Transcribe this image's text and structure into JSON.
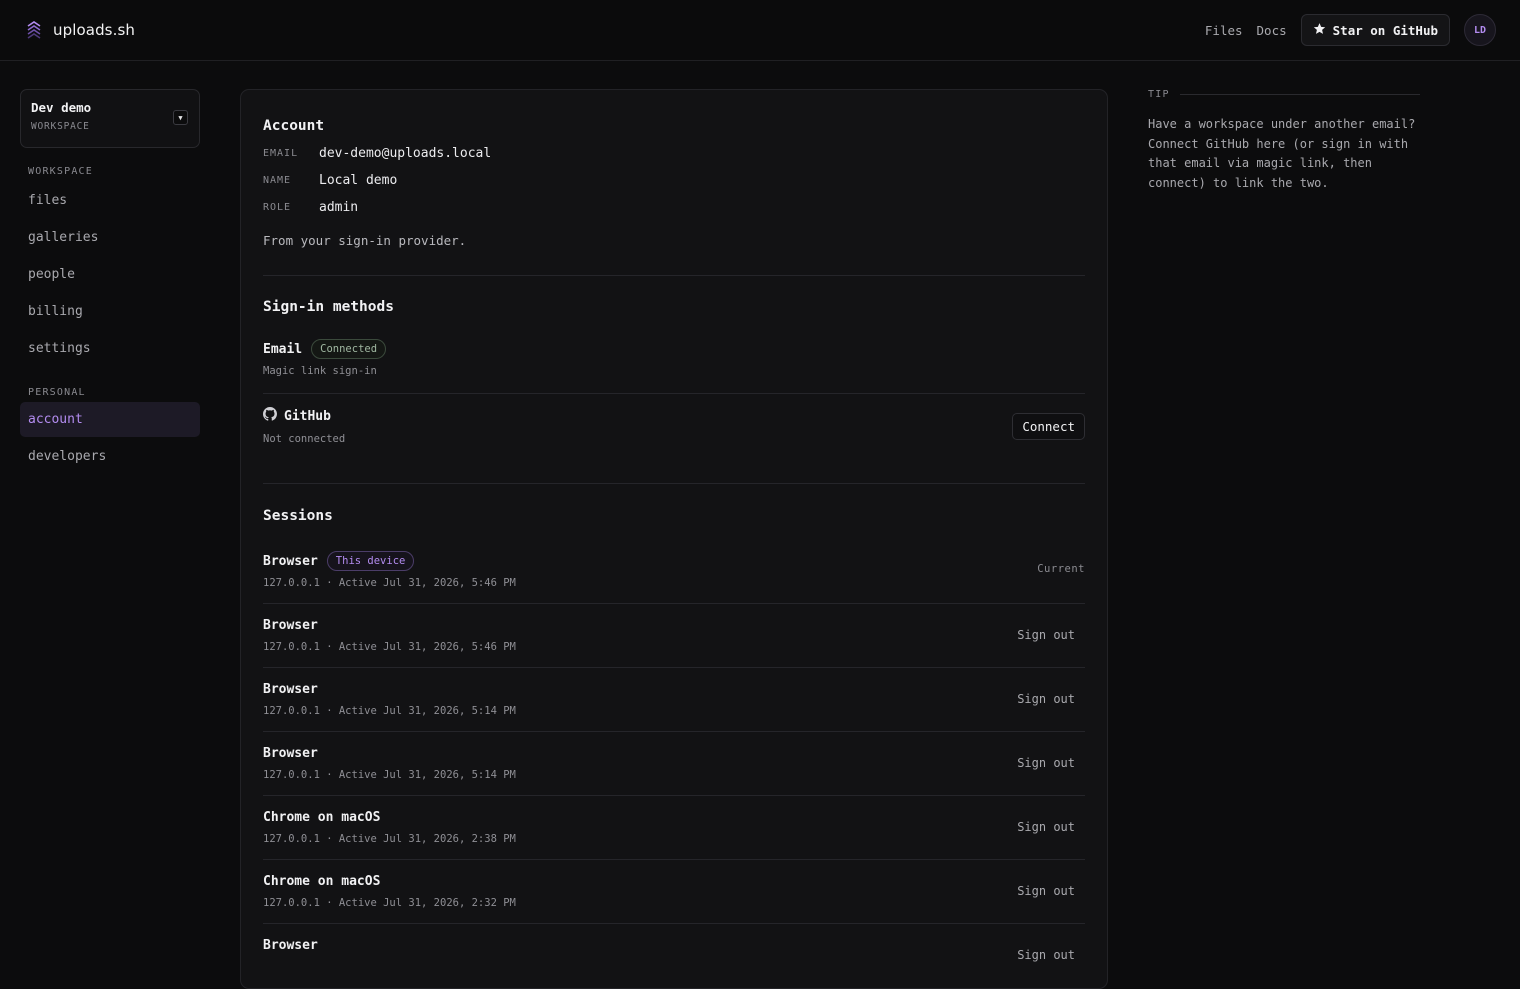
{
  "brand": {
    "name": "uploads.sh"
  },
  "topnav": {
    "files": "Files",
    "docs": "Docs",
    "star": "Star on GitHub",
    "avatar_initials": "LD"
  },
  "sidebar": {
    "workspace_name": "Dev demo",
    "workspace_sub": "WORKSPACE",
    "section_workspace": "WORKSPACE",
    "workspace_items": [
      "files",
      "galleries",
      "people",
      "billing",
      "settings"
    ],
    "section_personal": "PERSONAL",
    "personal_items": [
      "account",
      "developers"
    ],
    "active": "account"
  },
  "account": {
    "title": "Account",
    "email_label": "EMAIL",
    "email": "dev-demo@uploads.local",
    "name_label": "NAME",
    "name": "Local demo",
    "role_label": "ROLE",
    "role": "admin",
    "note": "From your sign-in provider."
  },
  "signin": {
    "title": "Sign-in methods",
    "email": {
      "label": "Email",
      "badge": "Connected",
      "sub": "Magic link sign-in"
    },
    "github": {
      "label": "GitHub",
      "sub": "Not connected",
      "button": "Connect"
    }
  },
  "sessions": {
    "title": "Sessions",
    "items": [
      {
        "name": "Browser",
        "badge": "This device",
        "detail": "127.0.0.1 · Active Jul 31, 2026, 5:46 PM",
        "action": "Current"
      },
      {
        "name": "Browser",
        "detail": "127.0.0.1 · Active Jul 31, 2026, 5:46 PM",
        "action": "Sign out"
      },
      {
        "name": "Browser",
        "detail": "127.0.0.1 · Active Jul 31, 2026, 5:14 PM",
        "action": "Sign out"
      },
      {
        "name": "Browser",
        "detail": "127.0.0.1 · Active Jul 31, 2026, 5:14 PM",
        "action": "Sign out"
      },
      {
        "name": "Chrome on macOS",
        "detail": "127.0.0.1 · Active Jul 31, 2026, 2:38 PM",
        "action": "Sign out"
      },
      {
        "name": "Chrome on macOS",
        "detail": "127.0.0.1 · Active Jul 31, 2026, 2:32 PM",
        "action": "Sign out"
      },
      {
        "name": "Browser",
        "detail": "",
        "action": "Sign out"
      }
    ]
  },
  "tip": {
    "label": "TIP",
    "text": "Have a workspace under another email? Connect GitHub here (or sign in with that email via magic link, then connect) to link the two."
  },
  "colors": {
    "accent": "#b38cf0",
    "background": "#0c0c0d",
    "card": "#121214",
    "connected": "#9fb6a0"
  }
}
